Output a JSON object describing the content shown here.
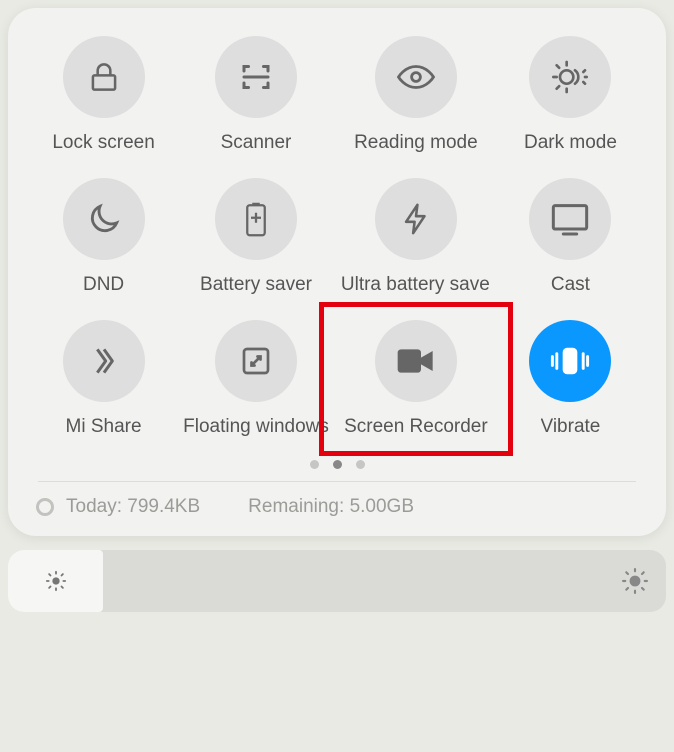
{
  "tiles": [
    [
      {
        "id": "lock-screen",
        "label": "Lock screen",
        "active": false
      },
      {
        "id": "scanner",
        "label": "Scanner",
        "active": false
      },
      {
        "id": "reading-mode",
        "label": "Reading mode",
        "active": false
      },
      {
        "id": "dark-mode",
        "label": "Dark mode",
        "active": false
      }
    ],
    [
      {
        "id": "dnd",
        "label": "DND",
        "active": false
      },
      {
        "id": "battery-saver",
        "label": "Battery saver",
        "active": false
      },
      {
        "id": "ultra-battery",
        "label": "Ultra battery saver",
        "active": false
      },
      {
        "id": "cast",
        "label": "Cast",
        "active": false
      }
    ],
    [
      {
        "id": "mi-share",
        "label": "Mi Share",
        "active": false
      },
      {
        "id": "floating-windows",
        "label": "Floating windows",
        "active": false
      },
      {
        "id": "screen-recorder",
        "label": "Screen Recorder",
        "active": false,
        "highlighted": true
      },
      {
        "id": "vibrate",
        "label": "Vibrate",
        "active": true
      }
    ]
  ],
  "pagination": {
    "count": 3,
    "active_index": 1
  },
  "status": {
    "today_label": "Today:",
    "today_value": "799.4KB",
    "remaining_label": "Remaining:",
    "remaining_value": "5.00GB"
  },
  "colors": {
    "accent": "#0a98ff",
    "highlight": "#e3000f"
  }
}
